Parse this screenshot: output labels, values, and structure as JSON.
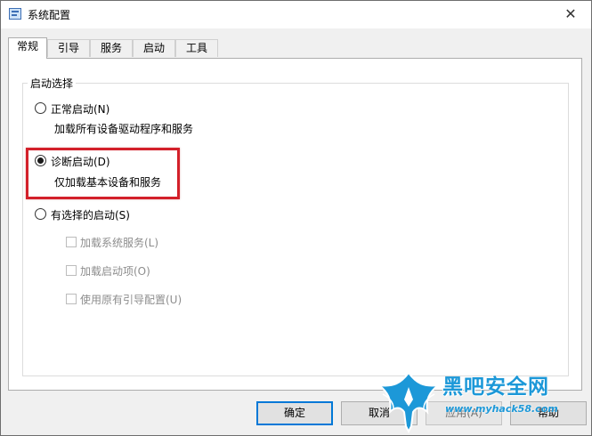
{
  "window": {
    "title": "系统配置",
    "close_glyph": "✕"
  },
  "tabs": [
    {
      "label": "常规",
      "active": true
    },
    {
      "label": "引导"
    },
    {
      "label": "服务"
    },
    {
      "label": "启动"
    },
    {
      "label": "工具"
    }
  ],
  "startup_selection": {
    "title": "启动选择",
    "normal": {
      "label": "正常启动(N)",
      "desc": "加载所有设备驱动程序和服务",
      "checked": false
    },
    "diagnostic": {
      "label": "诊断启动(D)",
      "desc": "仅加载基本设备和服务",
      "checked": true
    },
    "selective": {
      "label": "有选择的启动(S)",
      "checked": false,
      "options": [
        {
          "label": "加载系统服务(L)",
          "checked": false,
          "enabled": false
        },
        {
          "label": "加载启动项(O)",
          "checked": false,
          "enabled": false
        },
        {
          "label": "使用原有引导配置(U)",
          "checked": false,
          "enabled": false
        }
      ]
    }
  },
  "buttons": {
    "ok": "确定",
    "cancel": "取消",
    "apply": "应用(A)",
    "help": "帮助"
  },
  "watermark": {
    "name": "黑吧安全网",
    "url": "www.myhack58.com"
  },
  "colors": {
    "highlight_box": "#d3202a",
    "primary_focus": "#0078d7",
    "watermark": "#1c98d8"
  },
  "icons": {
    "app": "msconfig-icon",
    "close": "close-icon"
  }
}
